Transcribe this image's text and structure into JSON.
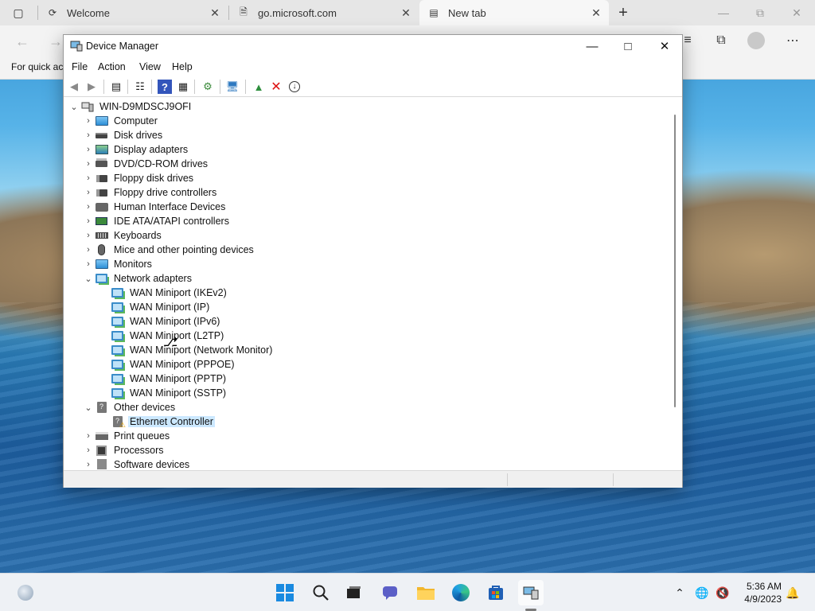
{
  "browser": {
    "tabs": [
      {
        "label": "Welcome",
        "icon": "refresh-edge-icon"
      },
      {
        "label": "go.microsoft.com",
        "icon": "document-icon"
      },
      {
        "label": "New tab",
        "icon": "newtab-icon"
      }
    ],
    "favorites_text": "For quick ac"
  },
  "window": {
    "title": "Device Manager",
    "menu": [
      "File",
      "Action",
      "View",
      "Help"
    ]
  },
  "tree": {
    "root": "WIN-D9MDSCJ9OFI",
    "categories": [
      {
        "label": "Computer",
        "icon": "monitor",
        "expanded": false
      },
      {
        "label": "Disk drives",
        "icon": "disk",
        "expanded": false
      },
      {
        "label": "Display adapters",
        "icon": "display",
        "expanded": false
      },
      {
        "label": "DVD/CD-ROM drives",
        "icon": "dvd",
        "expanded": false
      },
      {
        "label": "Floppy disk drives",
        "icon": "floppy",
        "expanded": false
      },
      {
        "label": "Floppy drive controllers",
        "icon": "floppy",
        "expanded": false
      },
      {
        "label": "Human Interface Devices",
        "icon": "hid",
        "expanded": false
      },
      {
        "label": "IDE ATA/ATAPI controllers",
        "icon": "ide",
        "expanded": false
      },
      {
        "label": "Keyboards",
        "icon": "kbd",
        "expanded": false
      },
      {
        "label": "Mice and other pointing devices",
        "icon": "mouse",
        "expanded": false
      },
      {
        "label": "Monitors",
        "icon": "monitor",
        "expanded": false
      },
      {
        "label": "Network adapters",
        "icon": "net",
        "expanded": true,
        "children": [
          "WAN Miniport (IKEv2)",
          "WAN Miniport (IP)",
          "WAN Miniport (IPv6)",
          "WAN Miniport (L2TP)",
          "WAN Miniport (Network Monitor)",
          "WAN Miniport (PPPOE)",
          "WAN Miniport (PPTP)",
          "WAN Miniport (SSTP)"
        ]
      },
      {
        "label": "Other devices",
        "icon": "other",
        "expanded": true,
        "children": [
          "Ethernet Controller"
        ]
      },
      {
        "label": "Print queues",
        "icon": "print",
        "expanded": false
      },
      {
        "label": "Processors",
        "icon": "proc",
        "expanded": false
      },
      {
        "label": "Software devices",
        "icon": "soft",
        "expanded": false
      }
    ],
    "selected": "Ethernet Controller"
  },
  "taskbar": {
    "time": "5:36 AM",
    "date": "4/9/2023"
  }
}
